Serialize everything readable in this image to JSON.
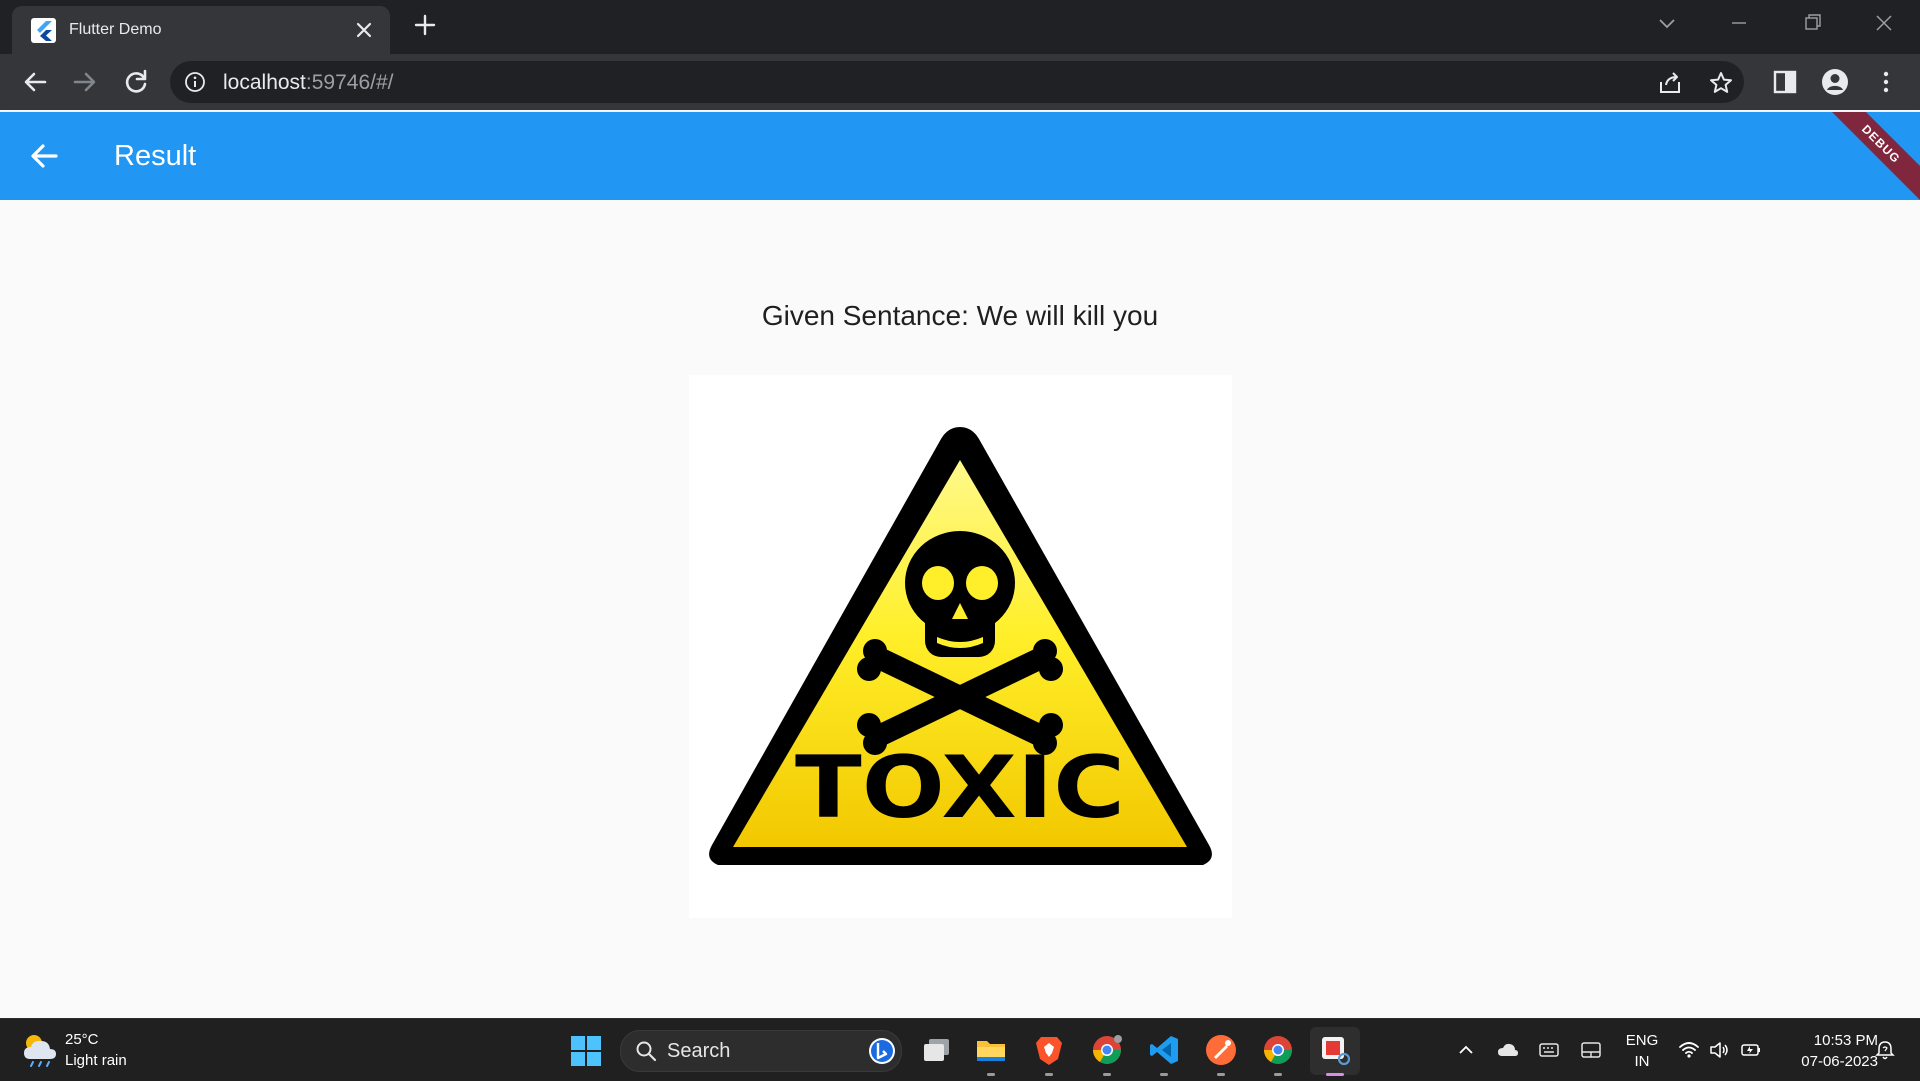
{
  "browser": {
    "tab_title": "Flutter Demo",
    "url_host": "localhost",
    "url_rest": ":59746/#/"
  },
  "app": {
    "title": "Result",
    "debug_banner": "DEBUG",
    "sentence": "Given Sentance: We will kill you",
    "result_image": {
      "label": "TOXIC",
      "icon": "skull-crossbones-icon",
      "colors": {
        "fill": "#ffe60a",
        "border": "#000000"
      }
    },
    "colors": {
      "appbar": "#2196f3",
      "background": "#fafafa"
    }
  },
  "taskbar": {
    "weather_temp": "25°C",
    "weather_desc": "Light rain",
    "search_placeholder": "Search",
    "lang_top": "ENG",
    "lang_bottom": "IN",
    "time": "10:53 PM",
    "date": "07-06-2023"
  }
}
